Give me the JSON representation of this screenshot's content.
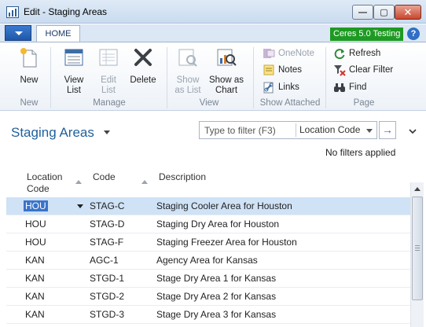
{
  "window": {
    "title": "Edit - Staging Areas",
    "min_glyph": "—",
    "max_glyph": "▢",
    "close_glyph": "✕"
  },
  "ribbon": {
    "tab": "HOME",
    "badge": "Ceres 5.0 Testing",
    "badge_color": "#1e9a22",
    "help_glyph": "?",
    "groups": {
      "new": "New",
      "manage": "Manage",
      "view": "View",
      "show_attached": "Show Attached",
      "page": "Page"
    },
    "buttons": {
      "new": "New",
      "view_list": "View List",
      "edit_list": "Edit List",
      "delete": "Delete",
      "show_as_list": "Show as List",
      "show_as_chart": "Show as Chart",
      "onenote": "OneNote",
      "notes": "Notes",
      "links": "Links",
      "refresh": "Refresh",
      "clear_filter": "Clear Filter",
      "find": "Find"
    }
  },
  "page": {
    "title": "Staging Areas",
    "filter_placeholder": "Type to filter (F3)",
    "filter_field": "Location Code",
    "go_glyph": "→",
    "no_filters": "No filters applied"
  },
  "grid": {
    "columns": [
      "Location Code",
      "Code",
      "Description"
    ],
    "rows": [
      {
        "location": "HOU",
        "code": "STAG-C",
        "description": "Staging Cooler Area for Houston"
      },
      {
        "location": "HOU",
        "code": "STAG-D",
        "description": "Staging Dry Area for Houston"
      },
      {
        "location": "HOU",
        "code": "STAG-F",
        "description": "Staging Freezer Area for Houston"
      },
      {
        "location": "KAN",
        "code": "AGC-1",
        "description": "Agency Area for Kansas"
      },
      {
        "location": "KAN",
        "code": "STGD-1",
        "description": "Stage Dry Area 1 for Kansas"
      },
      {
        "location": "KAN",
        "code": "STGD-2",
        "description": "Stage Dry Area 2 for Kansas"
      },
      {
        "location": "KAN",
        "code": "STGD-3",
        "description": "Stage Dry Area 3 for Kansas"
      }
    ]
  }
}
